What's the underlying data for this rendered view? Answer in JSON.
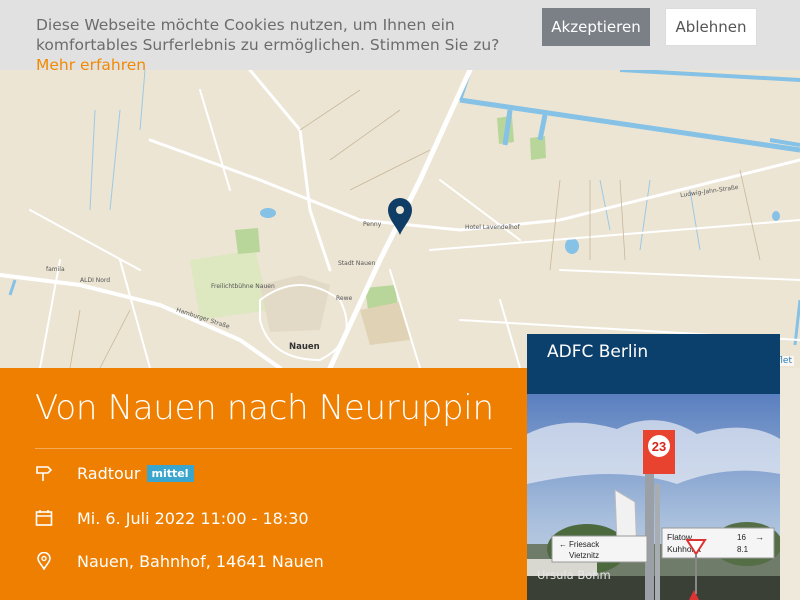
{
  "cookie": {
    "text": "Diese Webseite möchte Cookies nutzen, um Ihnen ein komfortables Surferlebnis zu ermöglichen. Stimmen Sie zu?",
    "more_link": "Mehr erfahren",
    "accept_label": "Akzeptieren",
    "decline_label": "Ablehnen",
    "accent": "#f28a00"
  },
  "map": {
    "labels": {
      "stadt_nauen": "Stadt Nauen",
      "nauen": "Nauen",
      "freilicht": "Freilichtbühne Nauen",
      "aldi": "ALDI Nord",
      "hotel": "Hotel Lavendelhof",
      "penny": "Penny",
      "rewe": "Rewe",
      "famila": "famila",
      "ludwig": "Ludwig-Jahn-Straße",
      "hamburger": "Hamburger Straße"
    },
    "attribution": "flet",
    "marker_color": "#0f3d66"
  },
  "event": {
    "title": "Von Nauen nach Neuruppin",
    "type": "Radtour",
    "level": "mittel",
    "datetime": "Mi. 6. Juli 2022 11:00 - 18:30",
    "location": "Nauen, Bahnhof, 14641 Nauen",
    "bg_color": "#ee7f01",
    "badge_color": "#3aa6cd"
  },
  "organizer": {
    "name": "ADFC Berlin",
    "photo_credit": "Ursula Bohm",
    "sign": {
      "route_number": "23",
      "left_top": "Friesack",
      "left_bottom": "Vietznitz",
      "right_top": "Flatow",
      "right_bottom": "Kuhhorst",
      "right_km_top": "16",
      "right_km_bottom": "8.1"
    }
  }
}
